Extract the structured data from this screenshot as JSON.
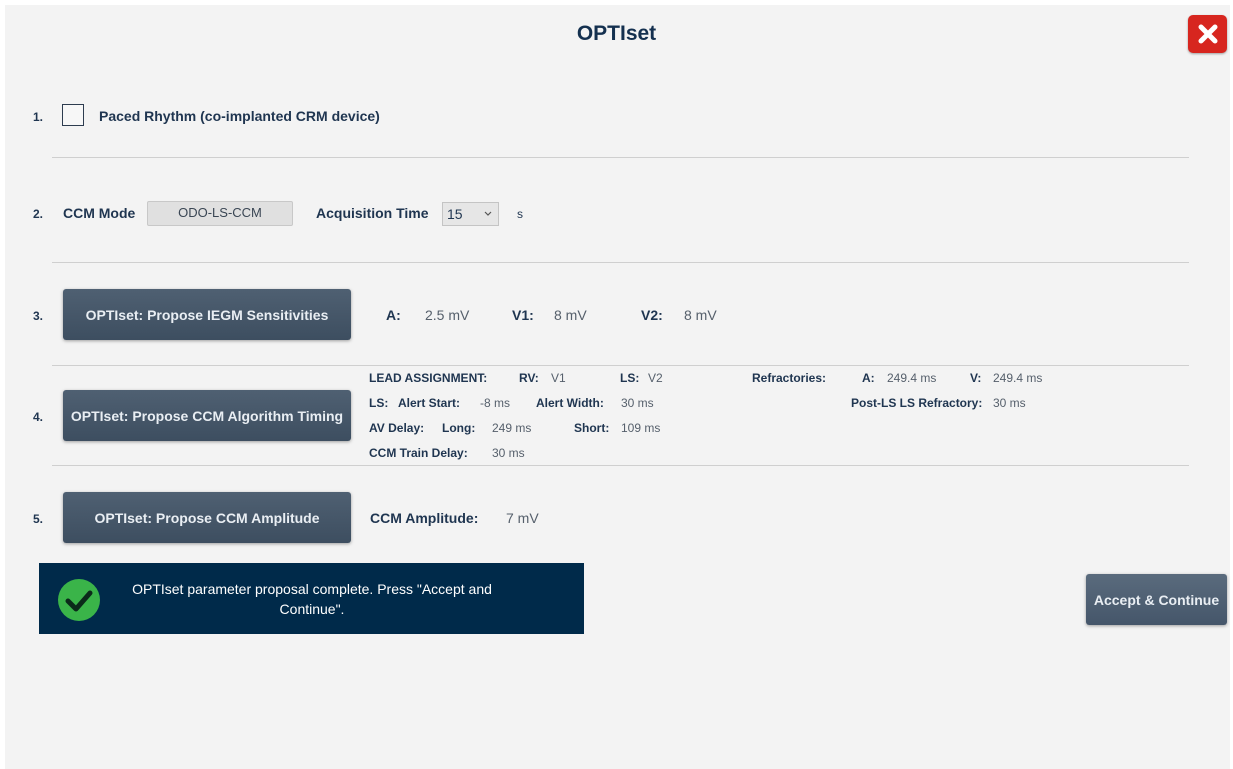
{
  "window": {
    "title": "OPTIset"
  },
  "colors": {
    "close": "#d7261f",
    "banner": "#002a4a",
    "button": "#4a5b6d",
    "success": "#3ab449"
  },
  "icons": {
    "close": "close-icon",
    "success": "checkmark-circle-icon",
    "dropdown": "chevron-down-icon"
  },
  "step1": {
    "num": "1.",
    "label": "Paced Rhythm (co-implanted CRM device)",
    "checked": false
  },
  "step2": {
    "num": "2.",
    "mode_label": "CCM Mode",
    "mode_value": "ODO-LS-CCM",
    "acq_label": "Acquisition Time",
    "acq_value": "15",
    "acq_unit": "s"
  },
  "step3": {
    "num": "3.",
    "button": "OPTIset: Propose IEGM Sensitivities",
    "a_label": "A:",
    "a_value": "2.5 mV",
    "v1_label": "V1:",
    "v1_value": "8 mV",
    "v2_label": "V2:",
    "v2_value": "8 mV"
  },
  "step4": {
    "num": "4.",
    "button": "OPTIset: Propose CCM Algorithm Timing",
    "lead_assignment_label": "LEAD ASSIGNMENT:",
    "rv_label": "RV:",
    "rv_value": "V1",
    "ls_label": "LS:",
    "ls_value": "V2",
    "refractories_label": "Refractories:",
    "ref_a_label": "A:",
    "ref_a_value": "249.4 ms",
    "ref_v_label": "V:",
    "ref_v_value": "249.4 ms",
    "ls_row_label": "LS:",
    "alert_start_label": "Alert Start:",
    "alert_start_value": "-8 ms",
    "alert_width_label": "Alert Width:",
    "alert_width_value": "30 ms",
    "post_ls_label": "Post-LS LS Refractory:",
    "post_ls_value": "30 ms",
    "av_delay_label": "AV Delay:",
    "long_label": "Long:",
    "long_value": "249 ms",
    "short_label": "Short:",
    "short_value": "109 ms",
    "train_delay_label": "CCM Train Delay:",
    "train_delay_value": "30 ms"
  },
  "step5": {
    "num": "5.",
    "button": "OPTIset: Propose CCM Amplitude",
    "amp_label": "CCM Amplitude:",
    "amp_value": "7 mV"
  },
  "status": {
    "line1": "OPTIset parameter proposal complete. Press \"Accept and",
    "line2": "Continue\"."
  },
  "accept_button": "Accept & Continue"
}
